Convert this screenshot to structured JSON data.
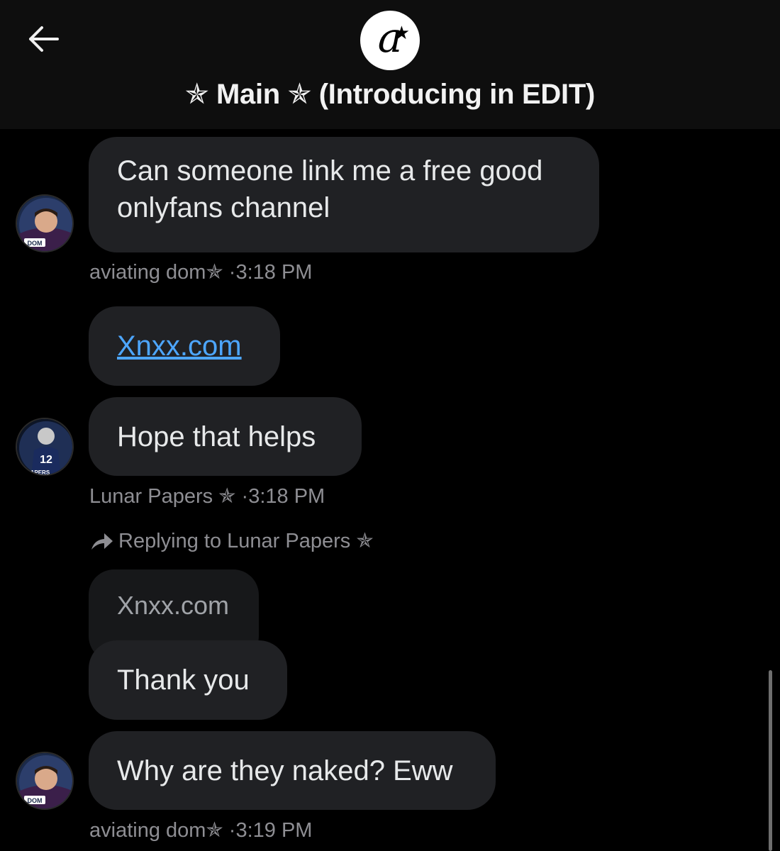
{
  "header": {
    "title": "✯ Main ✯ (Introducing in EDIT)",
    "logo_letter": "a",
    "logo_star": "★"
  },
  "messages": [
    {
      "text": "Can someone link me a free good onlyfans channel",
      "line1": "Can someone link me a free good",
      "line2": "onlyfans channel",
      "author": "aviating dom✯",
      "time": "·3:18 PM"
    },
    {
      "link": "Xnxx.com"
    },
    {
      "text": "Hope that helps",
      "author": "Lunar Papers ✯",
      "time": "·3:18 PM"
    },
    {
      "replying_to": "Replying to Lunar Papers ✯",
      "quoted": "Xnxx.com",
      "text": "Thank you"
    },
    {
      "text": "Why are they naked? Eww",
      "author": "aviating dom✯",
      "time": "·3:19 PM"
    }
  ],
  "avatars": {
    "dom_label": "DOM",
    "lunar_number": "12",
    "lunar_label": "PAPERS"
  }
}
